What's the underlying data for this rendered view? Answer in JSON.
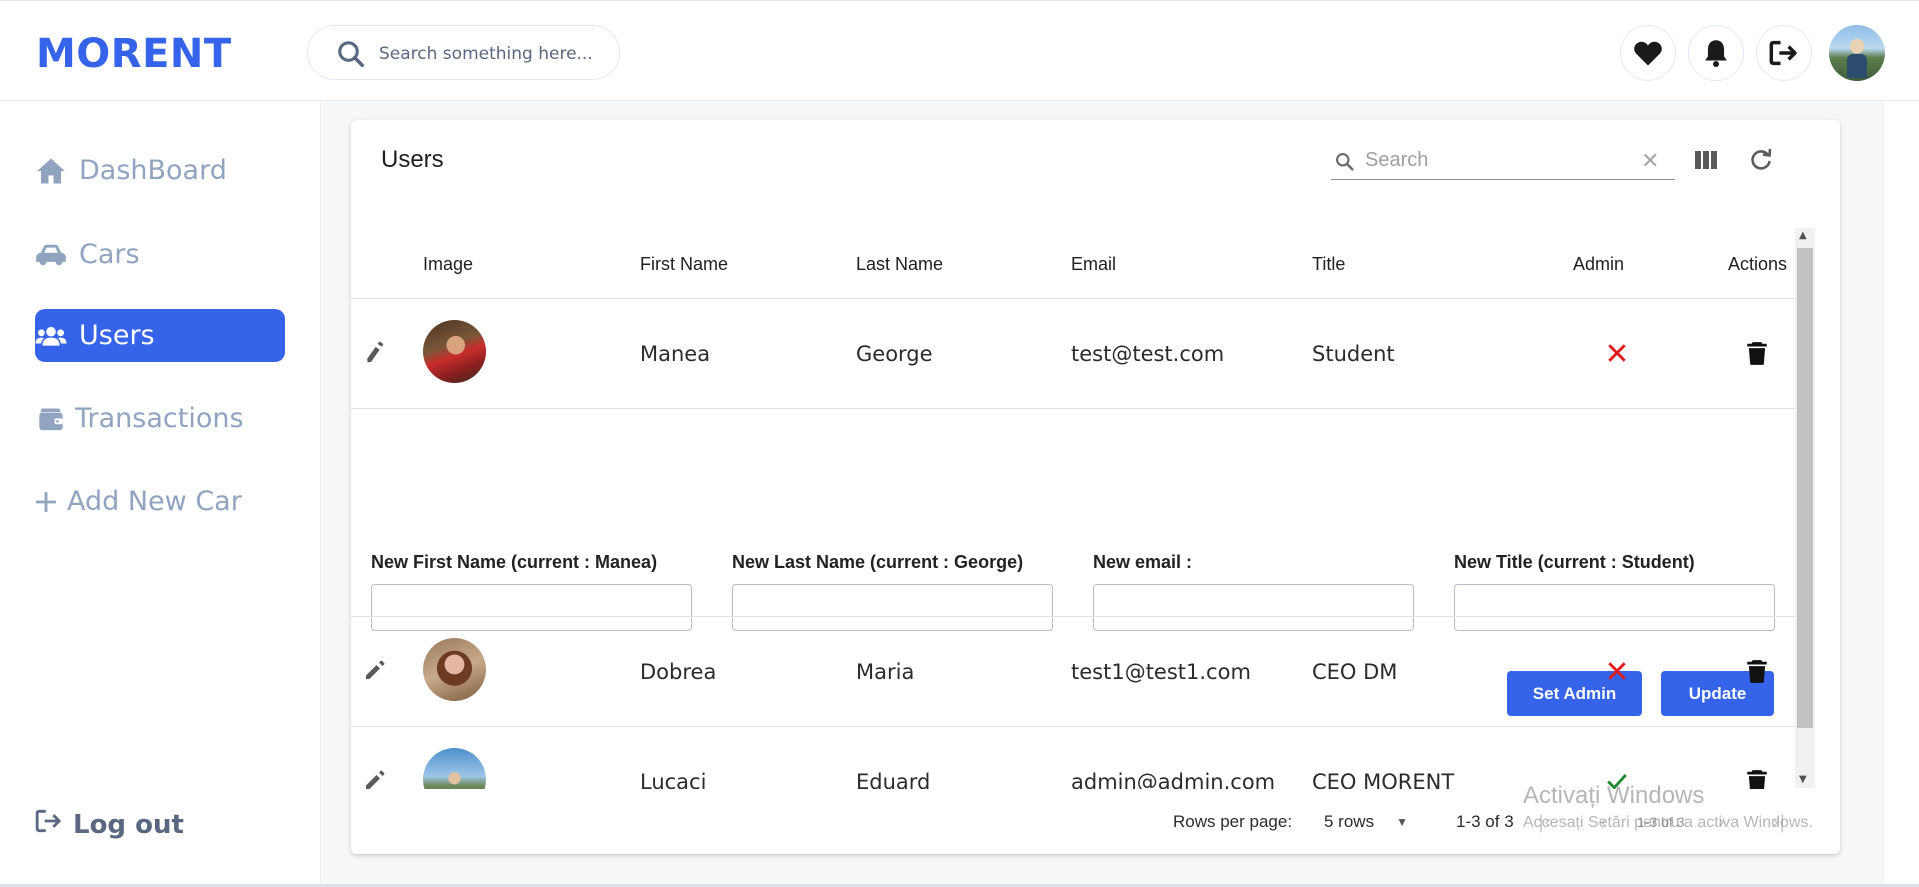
{
  "app": {
    "logo": "MORENT"
  },
  "topbar": {
    "search_placeholder": "Search something here...",
    "icons": [
      "heart-icon",
      "bell-icon",
      "logout-icon",
      "user-avatar"
    ]
  },
  "sidebar": {
    "items": [
      {
        "label": "DashBoard",
        "icon": "home-icon",
        "active": false
      },
      {
        "label": "Cars",
        "icon": "car-icon",
        "active": false
      },
      {
        "label": "Users",
        "icon": "users-icon",
        "active": true
      },
      {
        "label": "Transactions",
        "icon": "wallet-icon",
        "active": false
      },
      {
        "label": "Add New Car",
        "icon": "plus-icon",
        "active": false
      }
    ],
    "logout_label": "Log out"
  },
  "table": {
    "title": "Users",
    "search_placeholder": "Search",
    "columns": [
      "Image",
      "First Name",
      "Last Name",
      "Email",
      "Title",
      "Admin",
      "Actions"
    ],
    "rows": [
      {
        "first_name": "Manea",
        "last_name": "George",
        "email": "test@test.com",
        "title": "Student",
        "admin": false
      },
      {
        "first_name": "Dobrea",
        "last_name": "Maria",
        "email": "test1@test1.com",
        "title": "CEO DM",
        "admin": false
      },
      {
        "first_name": "Lucaci",
        "last_name": "Eduard",
        "email": "admin@admin.com",
        "title": "CEO MORENT",
        "admin": true
      }
    ],
    "edit_form": {
      "first_name_label": "New First Name (current : Manea)",
      "last_name_label": "New Last Name (current : George)",
      "email_label": "New email :",
      "title_label": "New Title (current : Student)",
      "set_admin_label": "Set Admin",
      "update_label": "Update"
    },
    "footer": {
      "rows_per_page_label": "Rows per page:",
      "rows_per_page_value": "5 rows",
      "range_text": "1-3 of 3",
      "range_text_small": "1-3 of 3"
    }
  },
  "watermark": {
    "line1": "Activați Windows",
    "line2": "Accesați Setări pentru a activa Windows."
  },
  "colors": {
    "brand": "#3563e9",
    "muted": "#90a3bf",
    "false_mark": "#e01b1b",
    "true_mark": "#1e8a2e"
  }
}
